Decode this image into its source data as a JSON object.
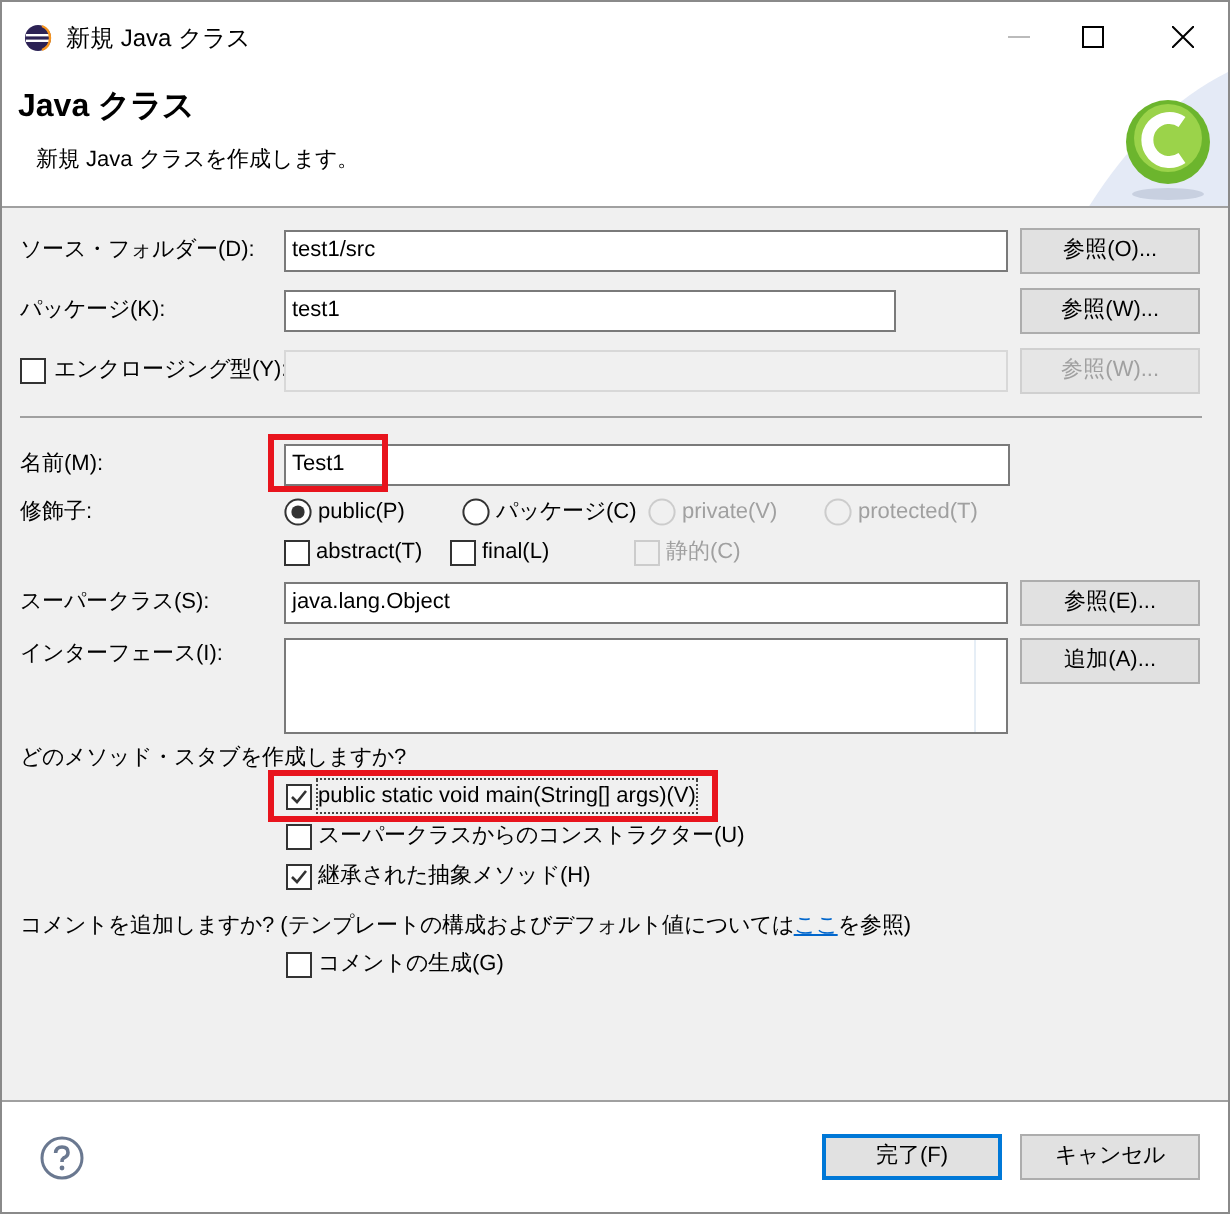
{
  "window": {
    "title": "新規 Java クラス"
  },
  "header": {
    "title": "Java クラス",
    "description": "新規 Java クラスを作成します。"
  },
  "source_folder": {
    "label": "ソース・フォルダー(D):",
    "value": "test1/src",
    "button": "参照(O)..."
  },
  "package": {
    "label": "パッケージ(K):",
    "value": "test1",
    "button": "参照(W)..."
  },
  "enclosing_type": {
    "label": "エンクロージング型(Y):",
    "checked": false,
    "disabled": true,
    "button": "参照(W)..."
  },
  "name": {
    "label": "名前(M):",
    "value": "Test1",
    "highlighted": true
  },
  "modifiers": {
    "label": "修飾子:",
    "access": [
      {
        "label": "public(P)",
        "selected": true,
        "disabled": false
      },
      {
        "label": "パッケージ(C)",
        "selected": false,
        "disabled": false
      },
      {
        "label": "private(V)",
        "selected": false,
        "disabled": true
      },
      {
        "label": "protected(T)",
        "selected": false,
        "disabled": true
      }
    ],
    "flags": [
      {
        "label": "abstract(T)",
        "checked": false,
        "disabled": false
      },
      {
        "label": "final(L)",
        "checked": false,
        "disabled": false
      },
      {
        "label": "静的(C)",
        "checked": false,
        "disabled": true
      }
    ]
  },
  "superclass": {
    "label": "スーパークラス(S):",
    "value": "java.lang.Object",
    "button": "参照(E)..."
  },
  "interfaces": {
    "label": "インターフェース(I):",
    "button": "追加(A)..."
  },
  "method_stubs": {
    "question": "どのメソッド・スタブを作成しますか?",
    "options": [
      {
        "label": "public static void main(String[] args)(V)",
        "checked": true,
        "highlighted": true
      },
      {
        "label": "スーパークラスからのコンストラクター(U)",
        "checked": false,
        "highlighted": false
      },
      {
        "label": "継承された抽象メソッド(H)",
        "checked": true,
        "highlighted": false
      }
    ]
  },
  "comments": {
    "question": "コメントを追加しますか? (テンプレートの構成およびデフォルト値については",
    "link": "ここ",
    "question_end": "を参照)",
    "options": [
      {
        "label": "コメントの生成(G)",
        "checked": false
      }
    ]
  },
  "buttons": [
    {
      "label": "完了(F)",
      "default": true
    },
    {
      "label": "キャンセル",
      "default": false
    }
  ]
}
